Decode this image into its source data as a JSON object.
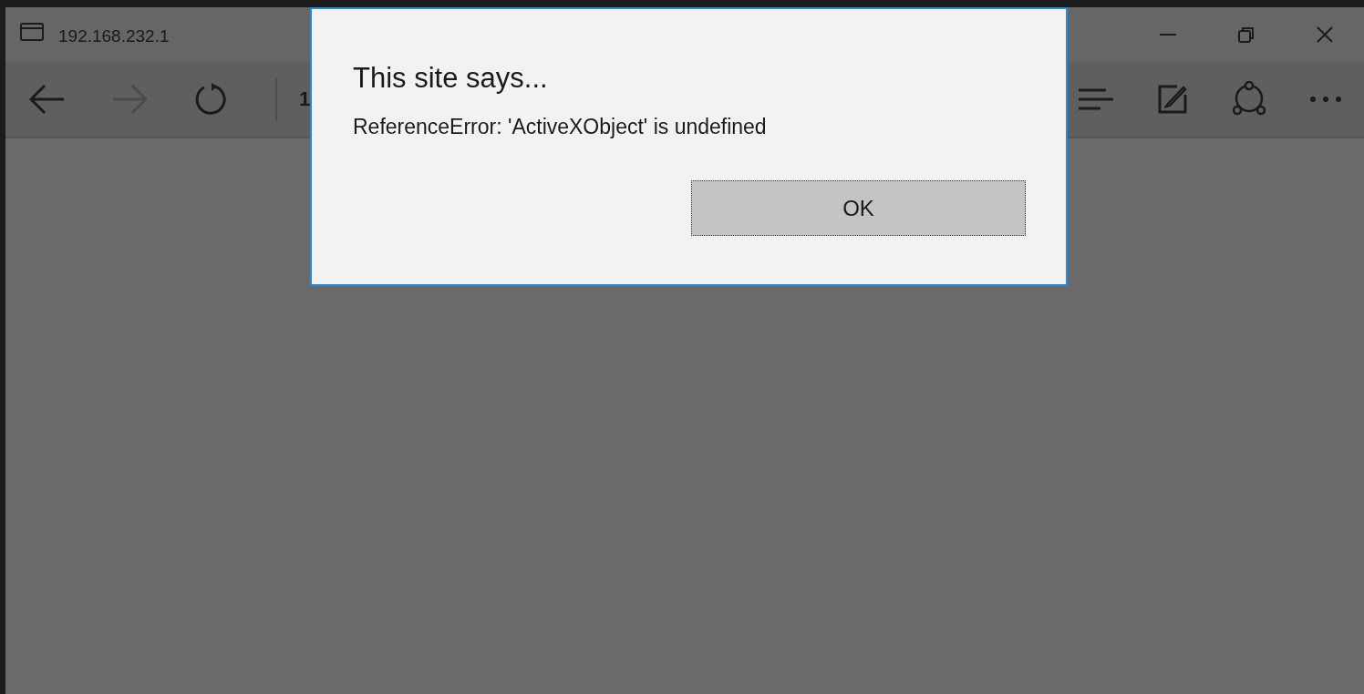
{
  "window": {
    "title": "192.168.232.1"
  },
  "toolbar": {
    "nav_buttons": [
      {
        "kind": "back",
        "disabled": false
      },
      {
        "kind": "forward",
        "disabled": true
      },
      {
        "kind": "refresh",
        "disabled": false
      }
    ],
    "address": "1"
  },
  "dialog": {
    "title": "This site says...",
    "message": "ReferenceError: 'ActiveXObject' is undefined",
    "buttons": [
      "OK"
    ]
  }
}
